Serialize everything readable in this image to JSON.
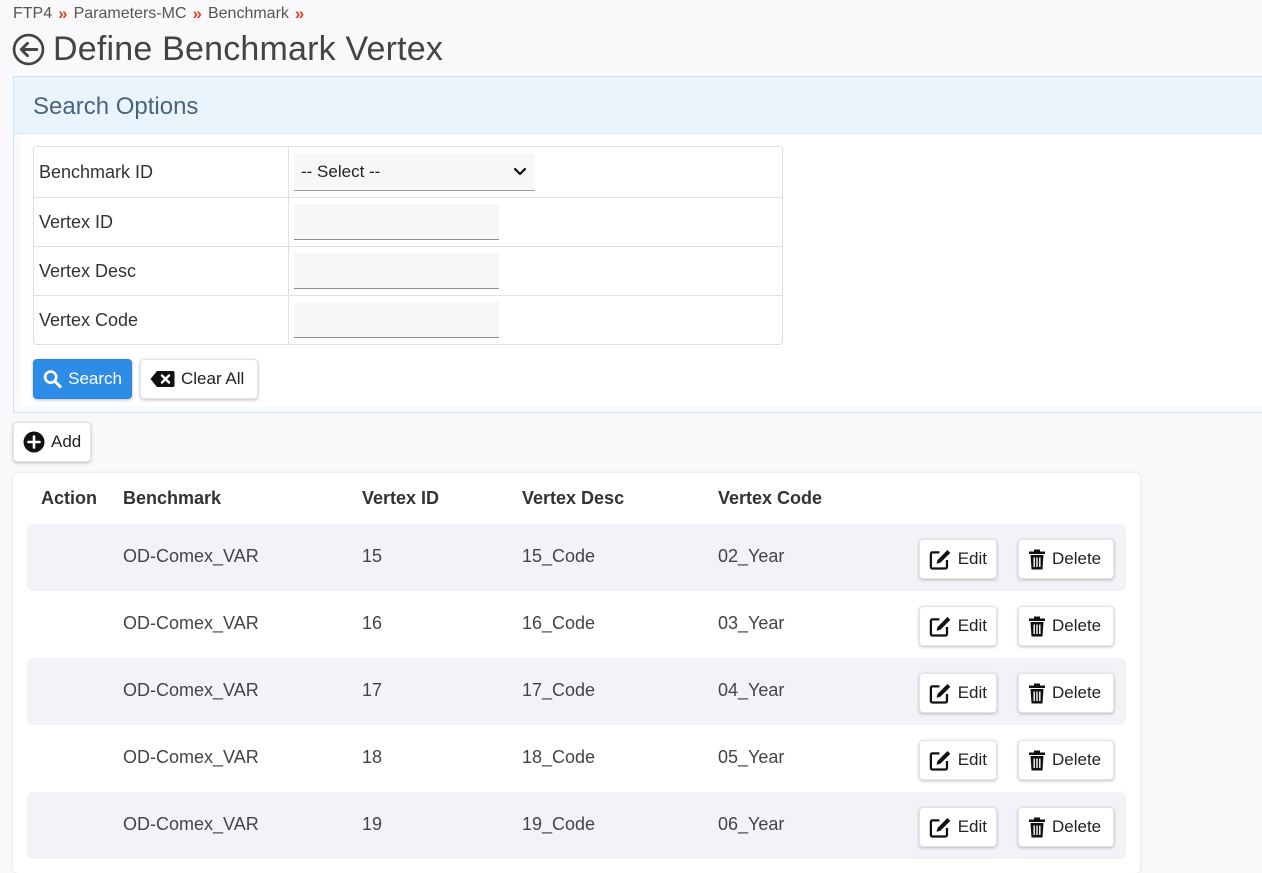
{
  "breadcrumb": [
    "FTP4",
    "Parameters-MC",
    "Benchmark"
  ],
  "breadcrumb_separator": "»",
  "page_title": "Define Benchmark Vertex",
  "search": {
    "title": "Search Options",
    "fields": {
      "benchmark_id": {
        "label": "Benchmark ID",
        "value": "-- Select --"
      },
      "vertex_id": {
        "label": "Vertex ID",
        "value": ""
      },
      "vertex_desc": {
        "label": "Vertex Desc",
        "value": ""
      },
      "vertex_code": {
        "label": "Vertex Code",
        "value": ""
      }
    },
    "search_label": "Search",
    "clear_label": "Clear All"
  },
  "add_label": "Add",
  "table": {
    "headers": {
      "action": "Action",
      "benchmark": "Benchmark",
      "vertex_id": "Vertex ID",
      "vertex_desc": "Vertex Desc",
      "vertex_code": "Vertex Code"
    },
    "edit_label": "Edit",
    "delete_label": "Delete",
    "rows": [
      {
        "benchmark": "OD-Comex_VAR",
        "vertex_id": "15",
        "vertex_desc": "15_Code",
        "vertex_code": "02_Year"
      },
      {
        "benchmark": "OD-Comex_VAR",
        "vertex_id": "16",
        "vertex_desc": "16_Code",
        "vertex_code": "03_Year"
      },
      {
        "benchmark": "OD-Comex_VAR",
        "vertex_id": "17",
        "vertex_desc": "17_Code",
        "vertex_code": "04_Year"
      },
      {
        "benchmark": "OD-Comex_VAR",
        "vertex_id": "18",
        "vertex_desc": "18_Code",
        "vertex_code": "05_Year"
      },
      {
        "benchmark": "OD-Comex_VAR",
        "vertex_id": "19",
        "vertex_desc": "19_Code",
        "vertex_code": "06_Year"
      }
    ]
  },
  "colors": {
    "primary": "#2d8ce6",
    "breadcrumb_separator": "#d9462b",
    "row_alt": "#f2f3f8",
    "panel_header": "#eaf4fc"
  }
}
